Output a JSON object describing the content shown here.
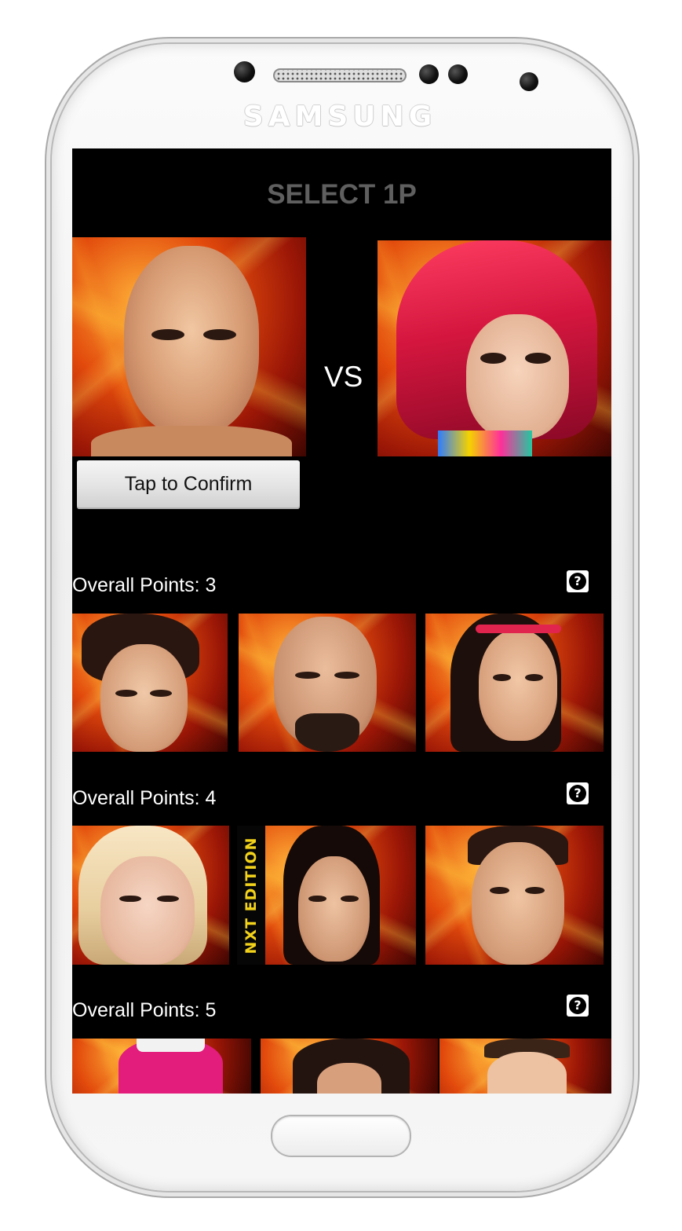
{
  "device": {
    "brand": "SAMSUNG"
  },
  "screen": {
    "title": "SELECT 1P",
    "vs_label": "VS",
    "confirm_label": "Tap to Confirm",
    "help_glyph": "?",
    "sections": [
      {
        "label": "Overall Points: 3",
        "cards": 3
      },
      {
        "label": "Overall Points: 4",
        "cards": 3
      },
      {
        "label": "Overall Points: 5",
        "cards": 3
      }
    ],
    "nxt_badge": "NXT EDITION"
  },
  "colors": {
    "background": "#000000",
    "title": "#5f5f5f",
    "text": "#ffffff",
    "nxt_badge": "#f2d21a"
  },
  "icons": {
    "help": "question-mark-circle-icon"
  }
}
